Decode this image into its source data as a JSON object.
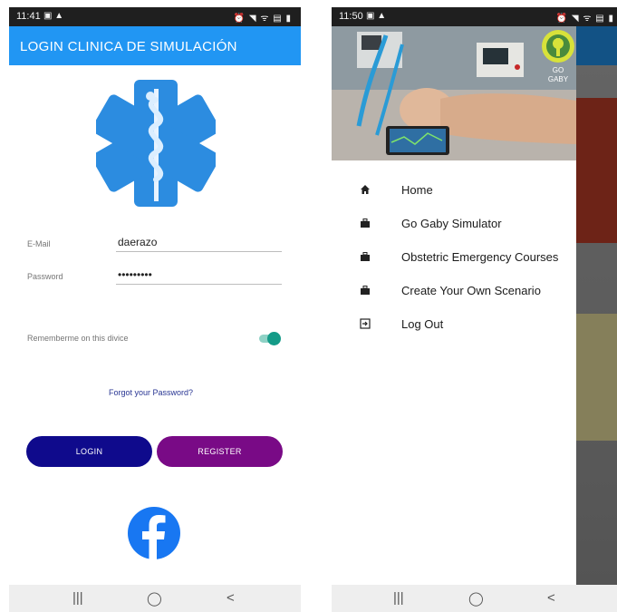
{
  "left_screen": {
    "status": {
      "time": "11:41",
      "left_icons": "▣ ▲",
      "right_icons": "⏰ ◥ ᯤ ▤ ▮"
    },
    "app_title": "LOGIN CLINICA DE SIMULACIÓN",
    "logo_icon": "star-of-life-icon",
    "email": {
      "label": "E-Mail",
      "value": "daerazo"
    },
    "password": {
      "label": "Password",
      "value": "•••••••••"
    },
    "remember": {
      "label": "Rememberme on this divice",
      "enabled": true
    },
    "forgot_link": "Forgot your Password?",
    "login_button": "LOGIN",
    "register_button": "REGISTER",
    "social_icon": "facebook-icon",
    "colors": {
      "appbar": "#2196f3",
      "login_button": "#0f0a8c",
      "register_button": "#790a86",
      "toggle": "#149b88"
    },
    "nav": {
      "recents": "|||",
      "home": "◯",
      "back": "<"
    }
  },
  "right_screen": {
    "status": {
      "time": "11:50",
      "left_icons": "▣ ▲",
      "right_icons": "⏰ ◥ ᯤ ▤ ▮"
    },
    "header_badge": "GO GABY",
    "menu": [
      {
        "icon": "home-icon",
        "label": "Home"
      },
      {
        "icon": "briefcase-icon",
        "label": "Go Gaby Simulator"
      },
      {
        "icon": "briefcase-icon",
        "label": "Obstetric Emergency Courses"
      },
      {
        "icon": "briefcase-icon",
        "label": "Create Your Own Scenario"
      },
      {
        "icon": "logout-icon",
        "label": "Log Out"
      }
    ],
    "nav": {
      "recents": "|||",
      "home": "◯",
      "back": "<"
    }
  }
}
